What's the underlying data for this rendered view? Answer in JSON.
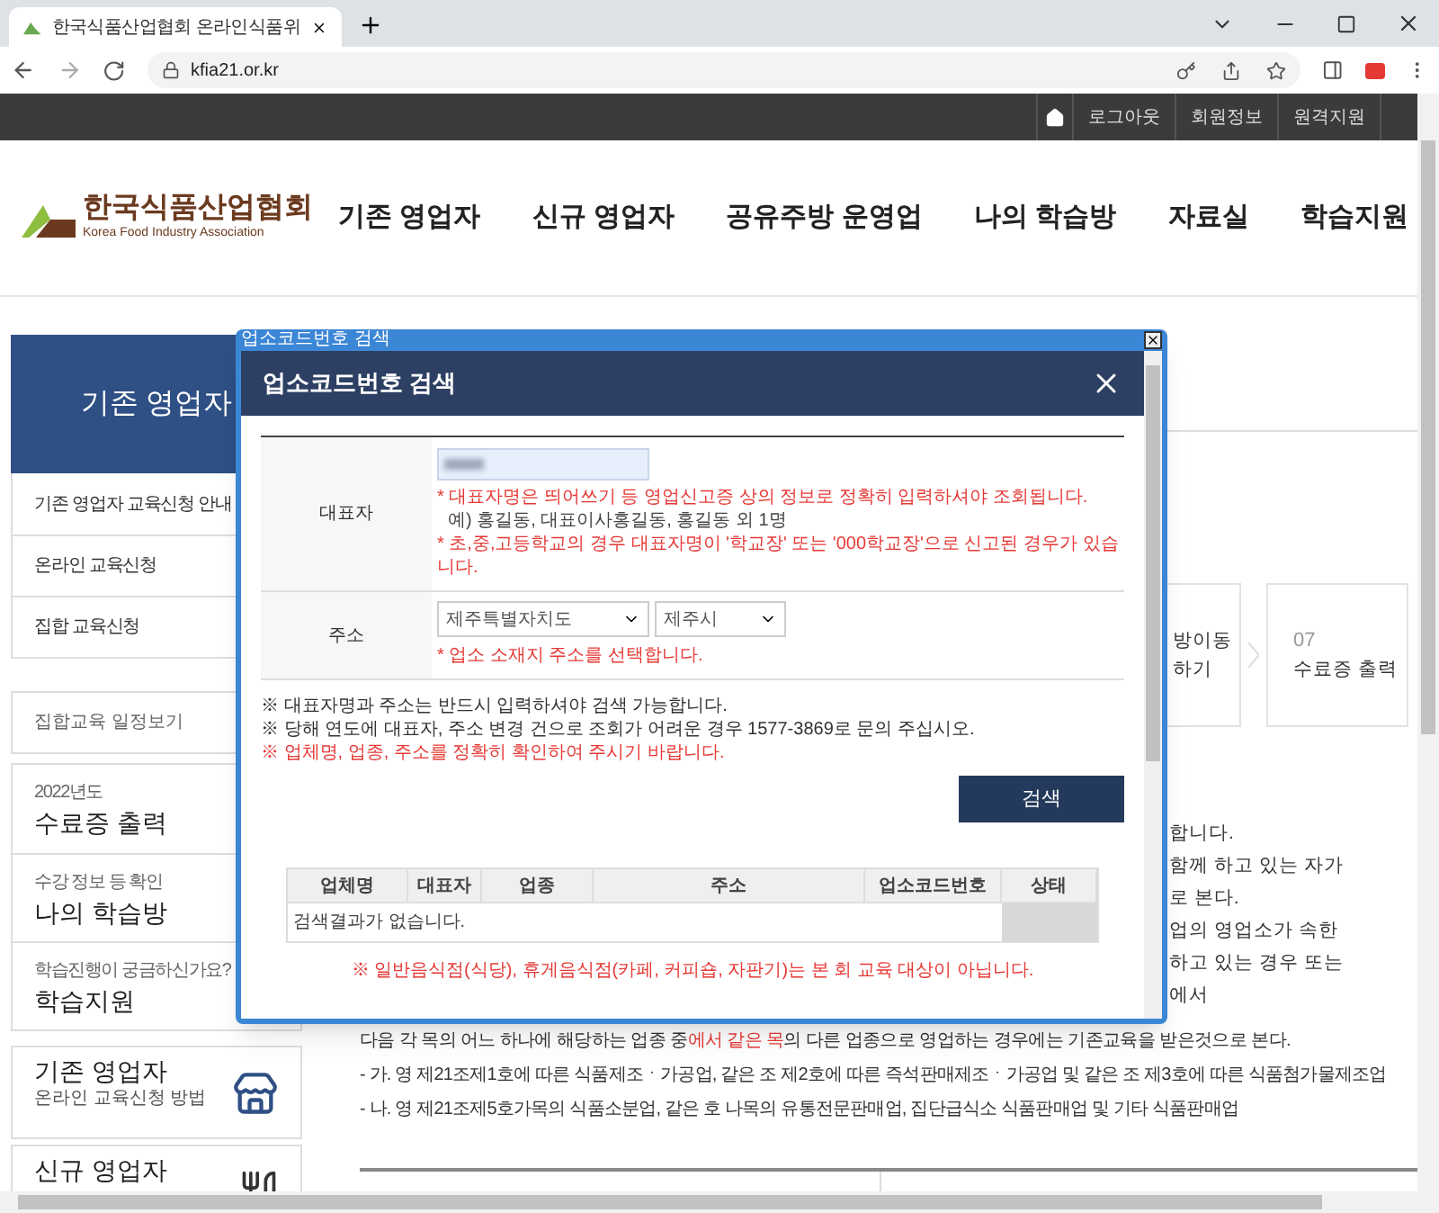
{
  "browser": {
    "tab_title": "한국식품산업협회 온라인식품위",
    "url": "kfia21.or.kr"
  },
  "top_bar": {
    "links": [
      "로그아웃",
      "회원정보",
      "원격지원"
    ]
  },
  "header": {
    "logo_korean": "한국식품산업협회",
    "logo_english": "Korea Food Industry Association",
    "nav": [
      "기존 영업자",
      "신규 영업자",
      "공유주방 운영업",
      "나의 학습방",
      "자료실",
      "학습지원"
    ]
  },
  "sidebar": {
    "title": "기존 영업자",
    "menu": [
      "기존 영업자 교육신청 안내",
      "온라인 교육신청",
      "집합 교육신청"
    ],
    "schedule_link": "집합교육 일정보기",
    "quick_links": [
      {
        "caption": "2022년도",
        "label": "수료증 출력"
      },
      {
        "caption": "수강 정보 등 확인",
        "label": "나의 학습방"
      },
      {
        "caption": "학습진행이 궁금하신가요?",
        "label": "학습지원"
      }
    ],
    "cards": [
      {
        "kind": "store",
        "title": "기존 영업자",
        "subtitle": "온라인 교육신청 방법"
      },
      {
        "kind": "dining",
        "title": "신규 영업자"
      }
    ]
  },
  "steps": [
    {
      "lines": [
        "방이동",
        "하기"
      ]
    },
    {
      "number": "07",
      "lines": [
        "수료증 출력"
      ]
    }
  ],
  "content": {
    "fragments": [
      "합니다.",
      "함께 하고 있는 자가",
      "로 본다.",
      "업의 영업소가 속한",
      "하고 있는 경우 또는",
      "에서"
    ],
    "rule_line": [
      {
        "text": "다음 각 목의 어느 하나에 해당하는 업종 중",
        "emphasis": false
      },
      {
        "text": "에서 같은 목",
        "emphasis": true
      },
      {
        "text": "의 다른 업종으로 영업하는 경우에는 기존교육을 받은것으로 본다.",
        "emphasis": false
      }
    ],
    "items": [
      "- 가. 영 제21조제1호에 따른 식품제조ㆍ가공업, 같은 조 제2호에 따른 즉석판매제조ㆍ가공업 및 같은 조 제3호에 따른 식품첨가물제조업",
      "- 나. 영 제21조제5호가목의 식품소분업, 같은 호 나목의 유통전문판매업, 집단급식소 식품판매업 및 기타 식품판매업"
    ]
  },
  "modal": {
    "window_title": "업소코드번호 검색",
    "title": "업소코드번호 검색",
    "representative": {
      "label": "대표자",
      "hints": [
        {
          "kind": "warning",
          "text": "* 대표자명은 띄어쓰기 등 영업신고증 상의 정보로 정확히 입력하셔야 조회됩니다."
        },
        {
          "kind": "example",
          "text": "예) 홍길동, 대표이사홍길동, 홍길동 외 1명"
        },
        {
          "kind": "warning",
          "text": "* 초,중,고등학교의 경우 대표자명이 '학교장' 또는 '000학교장'으로 신고된 경우가 있습니다."
        }
      ]
    },
    "address": {
      "label": "주소",
      "province": "제주특별자치도",
      "city": "제주시",
      "hint": "* 업소 소재지 주소를 선택합니다."
    },
    "notes": [
      {
        "kind": "info",
        "text": "※ 대표자명과 주소는 반드시 입력하셔야 검색 가능합니다."
      },
      {
        "kind": "info",
        "text": "※ 당해 연도에 대표자, 주소 변경 건으로 조회가 어려운 경우 1577-3869로 문의 주십시오."
      },
      {
        "kind": "warning",
        "text": "※ 업체명, 업종, 주소를 정확히 확인하여 주시기 바랍니다."
      }
    ],
    "search_button": "검색",
    "results": {
      "columns": [
        "업체명",
        "대표자",
        "업종",
        "주소",
        "업소코드번호",
        "상태"
      ],
      "empty_message": "검색결과가 없습니다."
    },
    "footer_note": "※ 일반음식점(식당), 휴게음식점(카페, 커피숍, 자판기)는 본 회 교육 대상이 아닙니다."
  }
}
